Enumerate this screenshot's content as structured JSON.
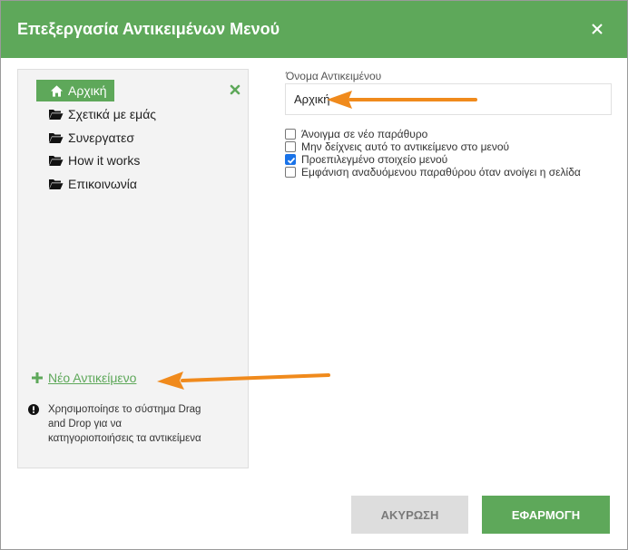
{
  "dialog": {
    "title": "Επεξεργασία Αντικειμένων Μενού"
  },
  "tree": {
    "items": [
      {
        "label": "Αρχική",
        "icon": "home-icon",
        "active": true
      },
      {
        "label": "Σχετικά με εμάς",
        "icon": "folder-icon"
      },
      {
        "label": "Συνεργατεσ",
        "icon": "folder-icon"
      },
      {
        "label": "How it works",
        "icon": "folder-icon"
      },
      {
        "label": "Επικοινωνία",
        "icon": "folder-icon"
      }
    ],
    "new_item_label": "Νέο Αντικείμενο",
    "info_text": "Χρησιμοποίησε το σύστημα Drag and Drop για να κατηγοριοποιήσεις τα αντικείμενα"
  },
  "form": {
    "name_label": "Όνομα Αντικειμένου",
    "name_value": "Αρχική",
    "options": [
      {
        "label": "Άνοιγμα σε νέο παράθυρο",
        "checked": false
      },
      {
        "label": "Μην δείχνεις αυτό το αντικείμενο στο μενού",
        "checked": false
      },
      {
        "label": "Προεπιλεγμένο στοιχείο μενού",
        "checked": true
      },
      {
        "label": "Εμφάνιση αναδυόμενου παραθύρου όταν ανοίγει η σελίδα",
        "checked": false
      }
    ]
  },
  "footer": {
    "cancel_label": "ΑΚΥΡΩΣΗ",
    "apply_label": "ΕΦΑΡΜΟΓΗ"
  },
  "colors": {
    "accent": "#5ea85a",
    "annotation_arrow": "#f08a1c",
    "checkbox": "#1a73e8"
  }
}
